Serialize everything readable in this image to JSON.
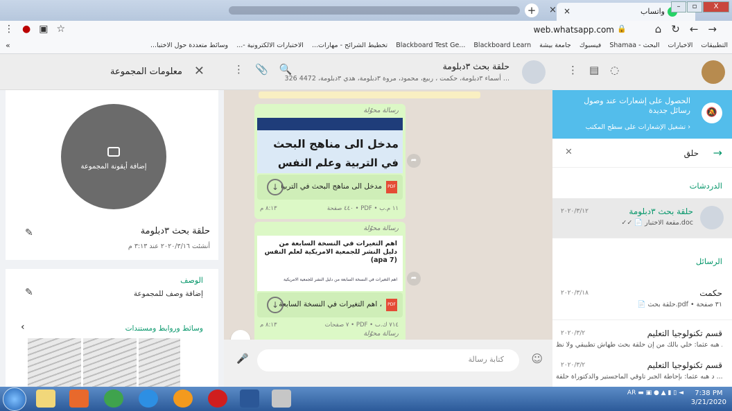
{
  "browser": {
    "other_tab_close": "×",
    "new_tab": "+",
    "wa_tab_title": "واتساب",
    "wa_tab_close": "×",
    "url": "web.whatsapp.com",
    "window_buttons": [
      "–",
      "▫",
      "X"
    ],
    "bookmarks": [
      "التطبيقات",
      "الاخبارات",
      "البحث - Shamaa",
      "فيسبوك",
      "جامعة بيشة",
      "Blackboard Test Ge...",
      "Blackboard Learn",
      "تخطيط الشرائح - مهارات...",
      "الاختبارات الالكترونية -...",
      "وسائط متعددة حول الاختبا..."
    ],
    "bookmarks_overflow": "«"
  },
  "group_info": {
    "title": "معلومات المجموعة",
    "avatar_label": "إضافة أيقونة المجموعة",
    "name": "حلقة بحث ٣دبلومة",
    "created": "أنشئت ٢٠٢٠/٣/١٦ عند ٣:١٣ م",
    "desc_label": "الوصف",
    "desc_value": "إضافة وصف للمجموعة",
    "media_label": "وسائط وروابط ومستندات"
  },
  "chat": {
    "name": "حلقة بحث ٣دبلومة",
    "members": "أسماء ٣دبلومة، حكمت ، ربيع، محمود، مروة ٣دبلومة، هدي ٣دبلومة، 4472 326 ...",
    "forwarded": "رسالة محوّلة",
    "msg1": {
      "preview_title": "مدخل الى مناهج البحث",
      "preview_sub": "في التربية وعلم النفس",
      "doc_name": "مدخل الى مناهج البحث في التربيا",
      "meta": "٤٤٠ صفحة • PDF • ١١ م.ب",
      "time": "٨:١٣ م"
    },
    "msg2": {
      "preview_text": "اهم التغيرات في النسخة السابعة من دليل النشر للجمعية الامريكية لعلم النفس (apa 7)",
      "preview_small": "اهم التغيرات في النسخة السابعة من دليل النشر للجمعية الامريكية",
      "doc_name": "اهم التغيرات في النسخة السابعة ،",
      "meta": "٧ صفحات • PDF • ٧١٤ ك.ب",
      "time": "٨:١٣ م"
    },
    "composer_placeholder": "كتابة رسالة"
  },
  "sidebar": {
    "notif_title": "الحصول على إشعارات عند وصول رسائل جديدة",
    "notif_link": "تشغيل الإشعارات على سطح المكتب ›",
    "search_query": "حلق",
    "section_chats": "الدردشات",
    "section_messages": "الرسائل",
    "items": [
      {
        "title": "حلقة بحث ٣دبلومة",
        "date": "٢٠٢٠/٣/١٢",
        "sub": "✓✓ 📄 مقعة الاختبار.doc"
      },
      {
        "title": "حكمت",
        "date": "٢٠٢٠/٣/١٨",
        "sub": "📄 حلقة بحث.pdf • ٣١ صفحة"
      },
      {
        "title": "قسم تكنولوجيا التعليم",
        "date": "٢٠٢٠/٣/٢",
        "sub": "د هبه عثما: خلي بالك من إن حلقة بحث طهاش تطبيقي ولا نظ..."
      },
      {
        "title": "قسم تكنولوجيا التعليم",
        "date": "٢٠٢٠/٣/٢",
        "sub": "د هبه عثما: بإحاطة الجبر تاوقي الماجستير والدكتوراة حلقة ..."
      }
    ]
  },
  "taskbar": {
    "lang": "AR",
    "time": "7:38 PM",
    "date": "3/21/2020"
  },
  "colors": {
    "accent": "#07976b",
    "notif": "#53bdeb",
    "bubble": "#dcf8c6"
  }
}
